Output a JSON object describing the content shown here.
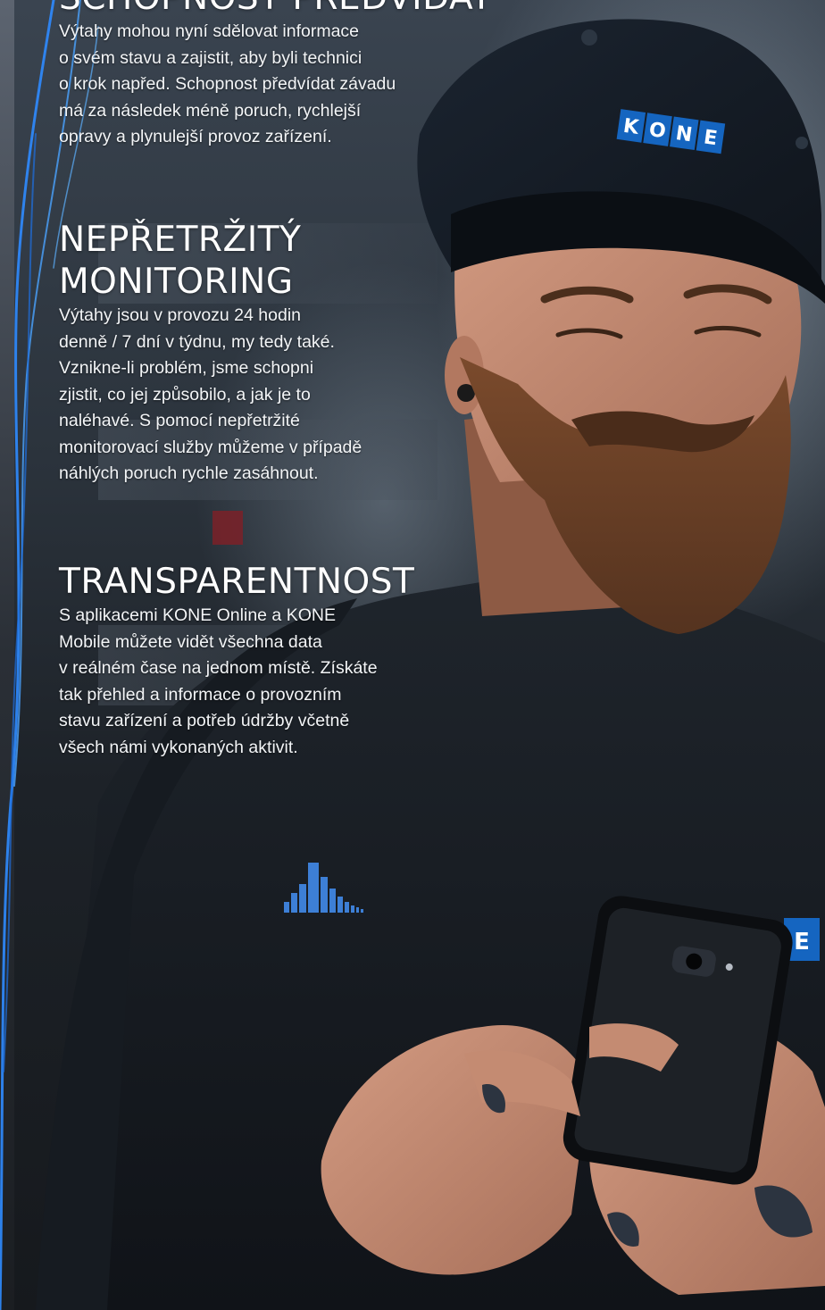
{
  "sections": [
    {
      "heading_lines": [
        "SCHOPNOST PŘEDVÍDAT"
      ],
      "body_lines": [
        "Výtahy mohou nyní sdělovat informace",
        "o svém stavu a zajistit, aby byli technici",
        "o krok napřed. Schopnost předvídat závadu",
        "má za následek méně poruch, rychlejší",
        "opravy a plynulejší provoz zařízení."
      ]
    },
    {
      "heading_lines": [
        "NEPŘETRŽITÝ",
        "MONITORING"
      ],
      "body_lines": [
        "Výtahy jsou v provozu 24 hodin",
        "denně / 7 dní v týdnu, my tedy také.",
        "Vznikne-li problém, jsme schopni",
        "zjistit, co jej způsobilo, a jak je to",
        "naléhavé. S pomocí nepřetržité",
        "monitorovací služby můžeme v případě",
        "náhlých poruch rychle zasáhnout."
      ]
    },
    {
      "heading_lines": [
        "TRANSPARENTNOST"
      ],
      "body_lines": [
        "S aplikacemi KONE Online a KONE",
        "Mobile můžete vidět všechna data",
        "v reálném čase na jednom místě. Získáte",
        "tak přehled a informace o provozním",
        "stavu zařízení a potřeb údržby včetně",
        "všech námi vykonaných aktivit."
      ]
    }
  ],
  "photo": {
    "cap_logo_letters": [
      "K",
      "O",
      "N",
      "E"
    ],
    "sleeve_logo_text": "E",
    "brand_color": "#1565c0",
    "accent_line_color": "#2f8bff"
  }
}
